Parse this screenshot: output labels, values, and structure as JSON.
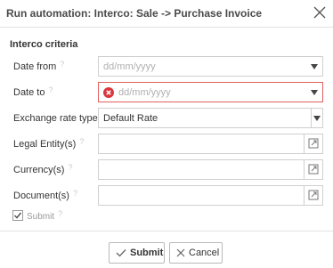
{
  "dialog": {
    "title": "Run automation: Interco: Sale -> Purchase Invoice",
    "close_icon": "close-icon"
  },
  "section": {
    "title": "Interco criteria"
  },
  "fields": {
    "date_from": {
      "label": "Date from",
      "placeholder": "dd/mm/yyyy",
      "help": "?"
    },
    "date_to": {
      "label": "Date to",
      "placeholder": "dd/mm/yyyy",
      "help": "?",
      "state": "error"
    },
    "exchange_rate_type": {
      "label": "Exchange rate type",
      "value": "Default Rate"
    },
    "legal_entities": {
      "label": "Legal Entity(s)",
      "help": "?",
      "value": ""
    },
    "currencies": {
      "label": "Currency(s)",
      "help": "?",
      "value": ""
    },
    "documents": {
      "label": "Document(s)",
      "help": "?",
      "value": ""
    }
  },
  "submit_checkbox": {
    "label": "Submit",
    "help": "?",
    "checked": true
  },
  "buttons": {
    "submit": "Submit",
    "cancel": "Cancel"
  },
  "colors": {
    "error": "#d9363e",
    "border": "#cfcfcf"
  }
}
